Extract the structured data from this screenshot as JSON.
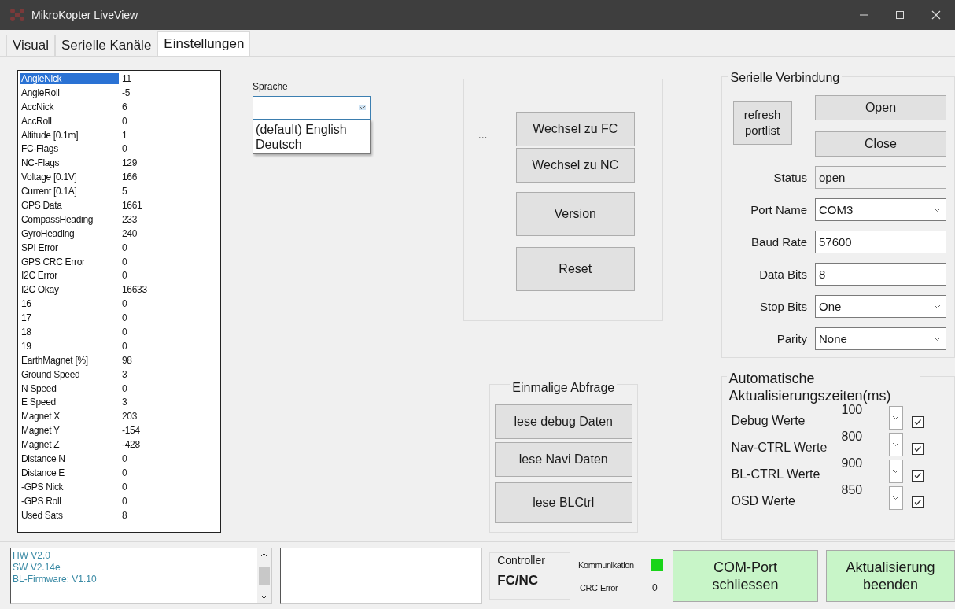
{
  "window": {
    "title": "MikroKopter LiveView"
  },
  "tabs": [
    {
      "label": "Visual",
      "selected": false
    },
    {
      "label": "Serielle Kanäle",
      "selected": false
    },
    {
      "label": "Einstellungen",
      "selected": true
    }
  ],
  "debug_list": [
    {
      "label": "AngleNick",
      "value": "11",
      "selected": true
    },
    {
      "label": "AngleRoll",
      "value": "-5",
      "selected": false
    },
    {
      "label": "AccNick",
      "value": "6",
      "selected": false
    },
    {
      "label": "AccRoll",
      "value": "0",
      "selected": false
    },
    {
      "label": "Altitude [0.1m]",
      "value": "1",
      "selected": false
    },
    {
      "label": "FC-Flags",
      "value": "0",
      "selected": false
    },
    {
      "label": "NC-Flags",
      "value": "129",
      "selected": false
    },
    {
      "label": "Voltage  [0.1V]",
      "value": "166",
      "selected": false
    },
    {
      "label": "Current  [0.1A]",
      "value": "5",
      "selected": false
    },
    {
      "label": "GPS Data",
      "value": "1661",
      "selected": false
    },
    {
      "label": "CompassHeading",
      "value": "233",
      "selected": false
    },
    {
      "label": "GyroHeading",
      "value": "240",
      "selected": false
    },
    {
      "label": "SPI Error",
      "value": "0",
      "selected": false
    },
    {
      "label": "GPS CRC Error",
      "value": "0",
      "selected": false
    },
    {
      "label": "I2C Error",
      "value": "0",
      "selected": false
    },
    {
      "label": "I2C Okay",
      "value": "16633",
      "selected": false
    },
    {
      "label": "16",
      "value": "0",
      "selected": false
    },
    {
      "label": "17",
      "value": "0",
      "selected": false
    },
    {
      "label": "18",
      "value": "0",
      "selected": false
    },
    {
      "label": "19",
      "value": "0",
      "selected": false
    },
    {
      "label": "EarthMagnet [%]",
      "value": "98",
      "selected": false
    },
    {
      "label": "Ground Speed",
      "value": "3",
      "selected": false
    },
    {
      "label": "N  Speed",
      "value": "0",
      "selected": false
    },
    {
      "label": "E  Speed",
      "value": "3",
      "selected": false
    },
    {
      "label": "Magnet X",
      "value": "203",
      "selected": false
    },
    {
      "label": "Magnet Y",
      "value": "-154",
      "selected": false
    },
    {
      "label": "Magnet Z",
      "value": "-428",
      "selected": false
    },
    {
      "label": "Distance N",
      "value": "0",
      "selected": false
    },
    {
      "label": "Distance E",
      "value": "0",
      "selected": false
    },
    {
      "label": "-GPS  Nick",
      "value": "0",
      "selected": false
    },
    {
      "label": "-GPS  Roll",
      "value": "0",
      "selected": false
    },
    {
      "label": "Used Sats",
      "value": "8",
      "selected": false
    }
  ],
  "language": {
    "label": "Sprache",
    "expanded": true,
    "options": [
      "(default) English",
      "Deutsch"
    ]
  },
  "controller_panel": {
    "ellipsis": "...",
    "buttons": [
      "Wechsel zu FC",
      "Wechsel zu NC",
      "Version",
      "Reset"
    ]
  },
  "single_query": {
    "title": "Einmalige Abfrage",
    "buttons": [
      "lese debug Daten",
      "lese Navi Daten",
      "lese BLCtrl"
    ]
  },
  "serial": {
    "title": "Serielle Verbindung",
    "refresh_button": "refresh portlist",
    "open_button": "Open",
    "close_button": "Close",
    "fields": [
      {
        "label": "Status",
        "value": "open",
        "kind": "readonly"
      },
      {
        "label": "Port Name",
        "value": "COM3",
        "kind": "dropdown"
      },
      {
        "label": "Baud Rate",
        "value": "57600",
        "kind": "text"
      },
      {
        "label": "Data Bits",
        "value": "8",
        "kind": "text"
      },
      {
        "label": "Stop Bits",
        "value": "One",
        "kind": "dropdown"
      },
      {
        "label": "Parity",
        "value": "None",
        "kind": "dropdown"
      }
    ]
  },
  "auto_update": {
    "title": "Automatische Aktualisierungszeiten(ms)",
    "rows": [
      {
        "label": "Debug Werte",
        "interval": "100",
        "checked": true
      },
      {
        "label": "Nav-CTRL Werte",
        "interval": "800",
        "checked": true
      },
      {
        "label": "BL-CTRL Werte",
        "interval": "900",
        "checked": true
      },
      {
        "label": "OSD Werte",
        "interval": "850",
        "checked": true
      }
    ]
  },
  "info_log": [
    "HW V2.0",
    "SW V2.14e",
    "BL-Firmware: V1.10"
  ],
  "controller": {
    "legend": "Controller",
    "value": "FC/NC"
  },
  "communication": {
    "label": "Kommunikation",
    "on": true
  },
  "crc": {
    "label": "CRC-Error",
    "value": "0"
  },
  "action_buttons": [
    "COM-Port schliessen",
    "Aktualisierung beenden"
  ]
}
